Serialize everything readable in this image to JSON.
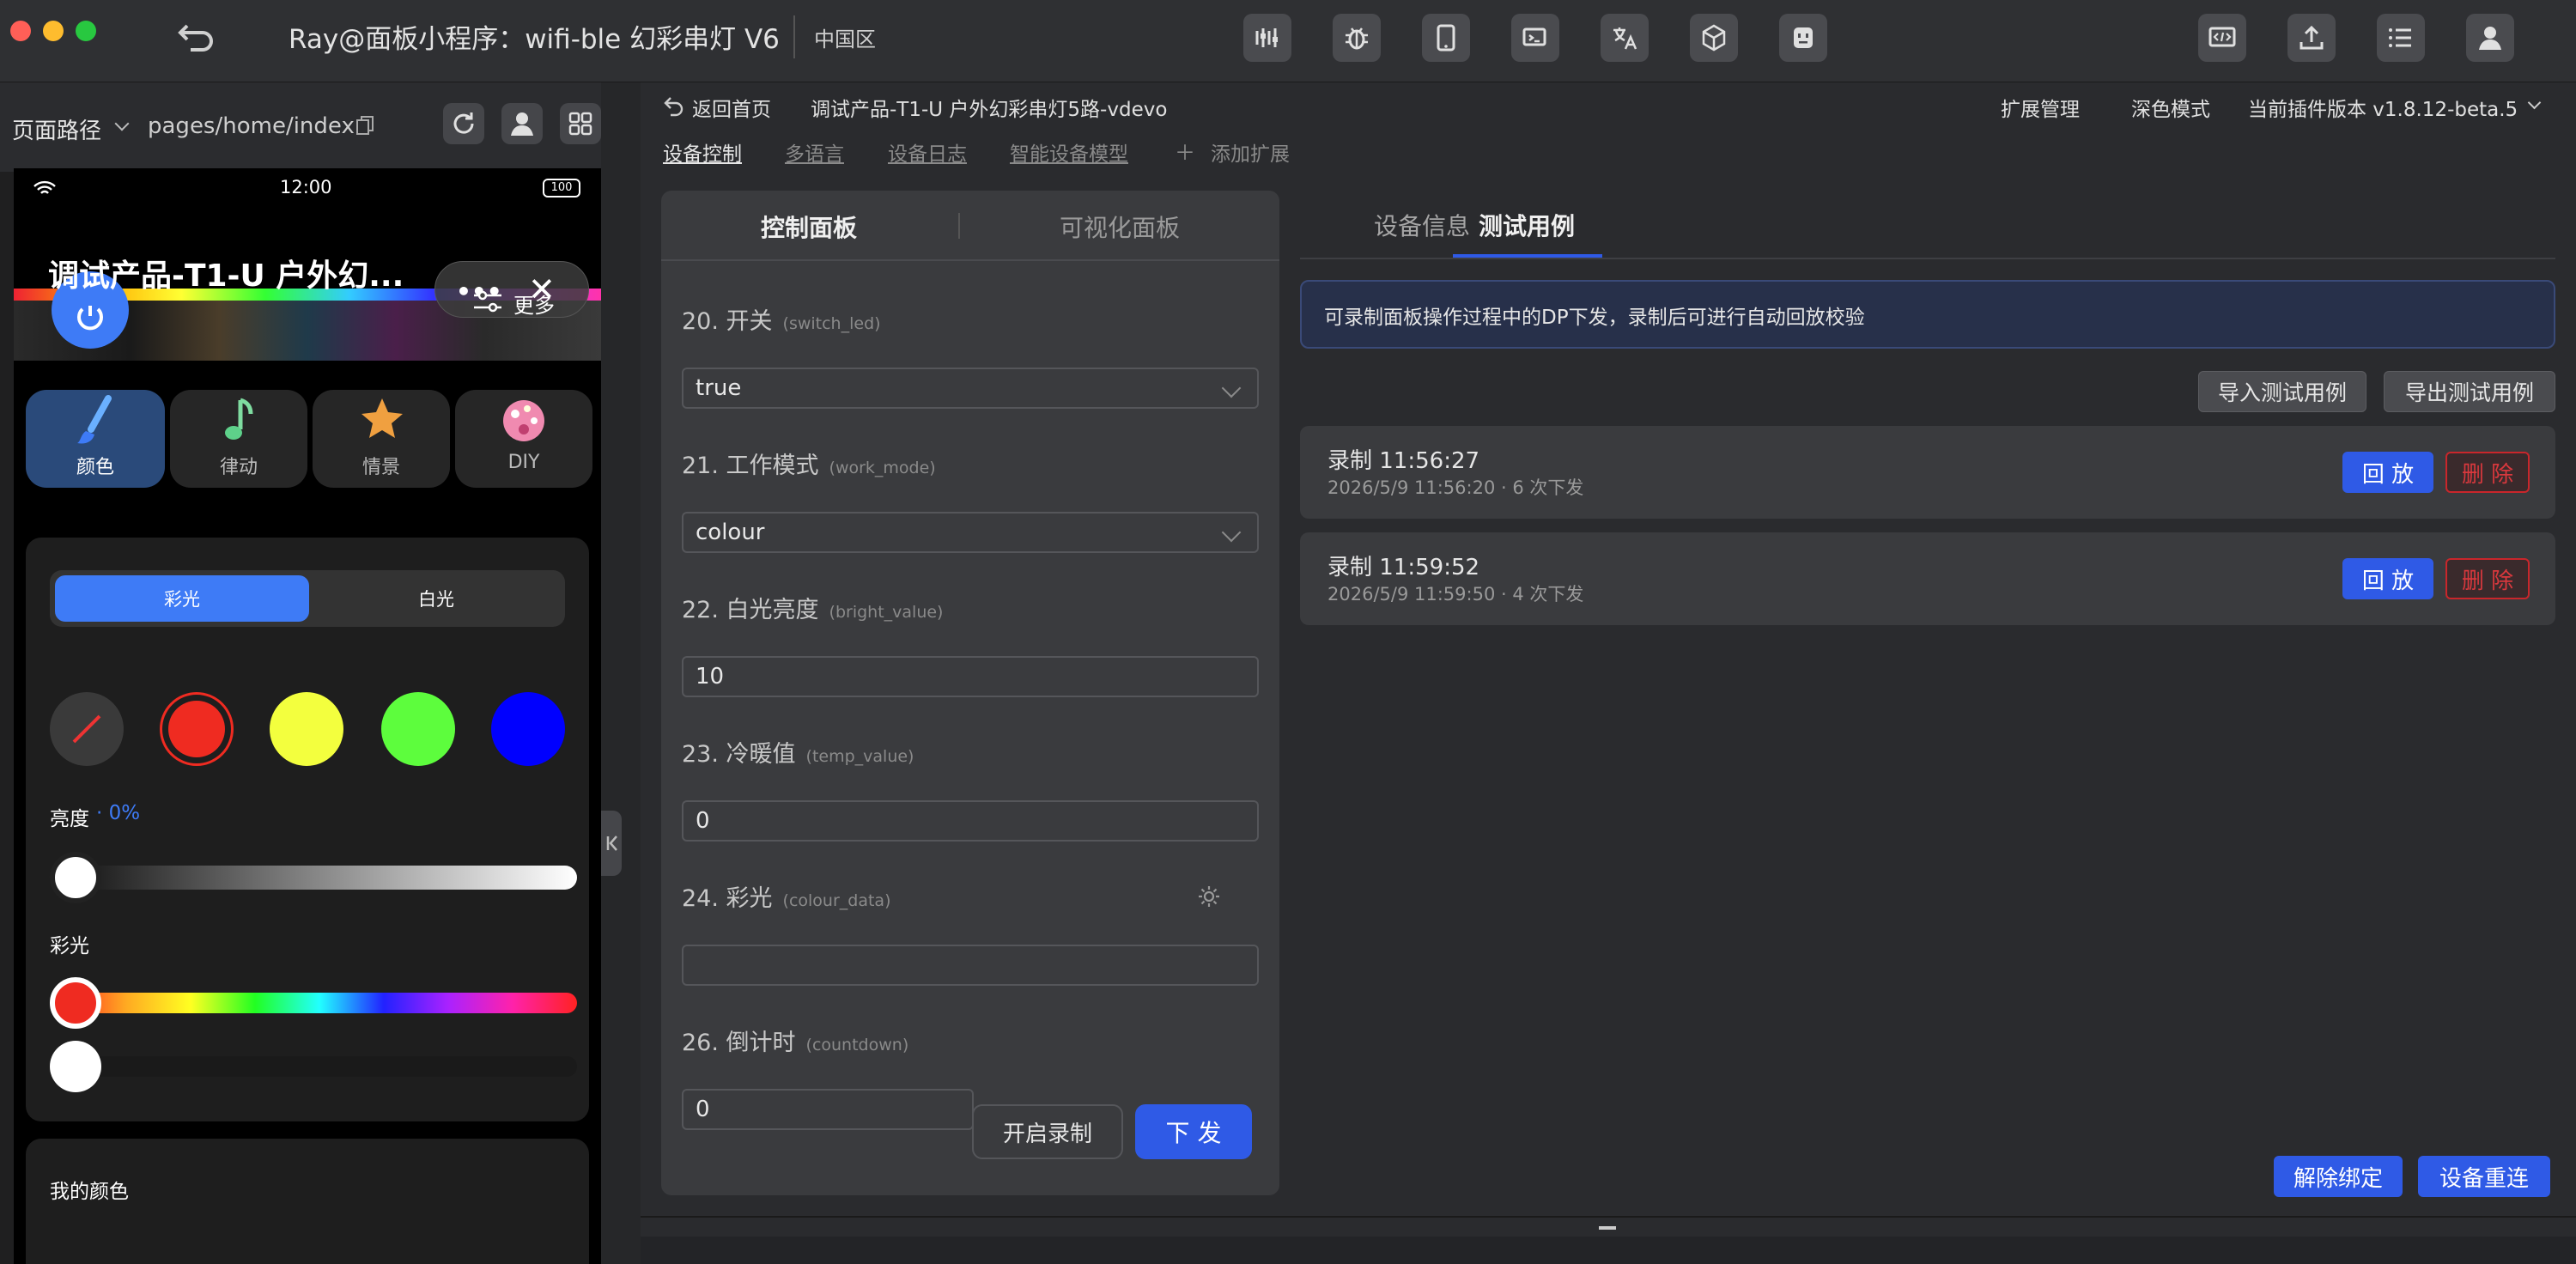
{
  "window": {
    "title": "Ray@面板小程序：wifi-ble 幻彩串灯 V6",
    "region": "中国区"
  },
  "toolbar_icons": [
    "sliders-icon",
    "bug-icon",
    "tablet-icon",
    "device-preview-icon",
    "translate-icon",
    "cube-icon",
    "robot-icon"
  ],
  "right_icons": [
    "code-screen-icon",
    "upload-icon",
    "list-icon",
    "user-icon"
  ],
  "page_path": {
    "label": "页面路径",
    "value": "pages/home/index"
  },
  "phone": {
    "time": "12:00",
    "battery": "100",
    "title": "调试产品-T1-U 户外幻...",
    "more": "更多",
    "modes": [
      "颜色",
      "律动",
      "情景",
      "DIY"
    ],
    "light_tabs": [
      "彩光",
      "白光"
    ],
    "brightness_label": "亮度",
    "brightness_value": "· 0%",
    "brightness_percent": 0,
    "colour_label": "彩光",
    "my_colors": "我的颜色",
    "swatches": [
      "#ef2b21",
      "#f3ff3e",
      "#5dfd3d",
      "#0000ff"
    ]
  },
  "nav": {
    "back": "返回首页",
    "product": "调试产品-T1-U 户外幻彩串灯5路-vdevo",
    "ext": "扩展管理",
    "dark": "深色模式",
    "version": "当前插件版本 v1.8.12-beta.5"
  },
  "subtabs": [
    "设备控制",
    "多语言",
    "设备日志",
    "智能设备模型"
  ],
  "add_ext": "添加扩展",
  "panel_tabs": [
    "控制面板",
    "可视化面板"
  ],
  "dps": [
    {
      "num": "20. 开关",
      "code": "(switch_led)",
      "value": "true",
      "type": "select"
    },
    {
      "num": "21. 工作模式",
      "code": "(work_mode)",
      "value": "colour",
      "type": "select"
    },
    {
      "num": "22. 白光亮度",
      "code": "(bright_value)",
      "value": "10",
      "type": "input"
    },
    {
      "num": "23. 冷暖值",
      "code": "(temp_value)",
      "value": "0",
      "type": "input"
    },
    {
      "num": "24. 彩光",
      "code": "(colour_data)",
      "value": "",
      "type": "input"
    },
    {
      "num": "26. 倒计时",
      "code": "(countdown)",
      "value": "0",
      "type": "input"
    }
  ],
  "record_btn": "开启录制",
  "send_btn": "下 发",
  "right_tabs": [
    "设备信息",
    "测试用例"
  ],
  "info": "可录制面板操作过程中的DP下发，录制后可进行自动回放校验",
  "import_btn": "导入测试用例",
  "export_btn": "导出测试用例",
  "records": [
    {
      "title": "录制 11:56:27",
      "sub": "2026/5/9 11:56:20 · 6 次下发",
      "play": "回 放",
      "del": "删 除"
    },
    {
      "title": "录制 11:59:52",
      "sub": "2026/5/9 11:59:50 · 4 次下发",
      "play": "回 放",
      "del": "删 除"
    }
  ],
  "bottom": {
    "unbind": "解除绑定",
    "reconnect": "设备重连"
  },
  "colors": {
    "accent": "#2f5ae6",
    "danger": "#c9262b",
    "phone_blue": "#3e7bf6"
  }
}
